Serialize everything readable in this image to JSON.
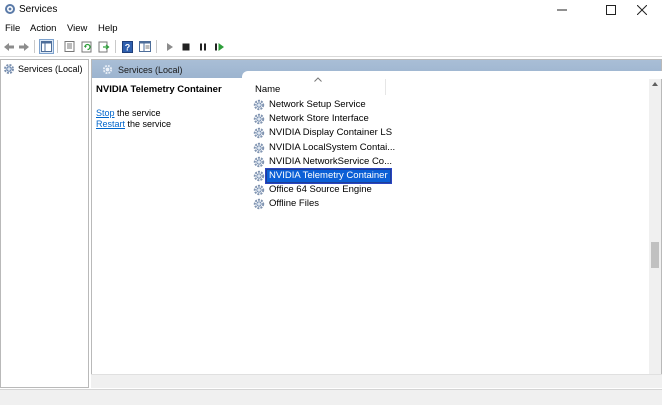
{
  "window": {
    "title": "Services"
  },
  "menu": {
    "items": [
      "File",
      "Action",
      "View",
      "Help"
    ]
  },
  "toolbar": {
    "buttons": [
      "back-arrow-icon",
      "forward-arrow-icon",
      "show-hide-console-tree-icon",
      "properties-icon",
      "refresh-icon",
      "export-list-icon",
      "help-icon",
      "extended-view-icon",
      "start-service-icon",
      "stop-service-icon",
      "pause-service-icon",
      "restart-service-icon"
    ]
  },
  "tree": {
    "root_label": "Services (Local)"
  },
  "pane": {
    "header_label": "Services (Local)",
    "selected_service_title": "NVIDIA Telemetry Container",
    "actions": [
      {
        "link": "Stop",
        "rest": " the service"
      },
      {
        "link": "Restart",
        "rest": " the service"
      }
    ]
  },
  "list": {
    "column_name": "Name",
    "rows": [
      {
        "name": "Network Setup Service"
      },
      {
        "name": "Network Store Interface"
      },
      {
        "name": "NVIDIA Display Container LS"
      },
      {
        "name": "NVIDIA LocalSystem Contai..."
      },
      {
        "name": "NVIDIA NetworkService Co..."
      },
      {
        "name": "NVIDIA Telemetry Container"
      },
      {
        "name": "Office 64 Source Engine"
      },
      {
        "name": "Offline Files"
      }
    ],
    "selected_index": 5
  },
  "colors": {
    "header_bar": "#a9bed6",
    "selection": "#0b5fd6",
    "link": "#0066cc"
  }
}
